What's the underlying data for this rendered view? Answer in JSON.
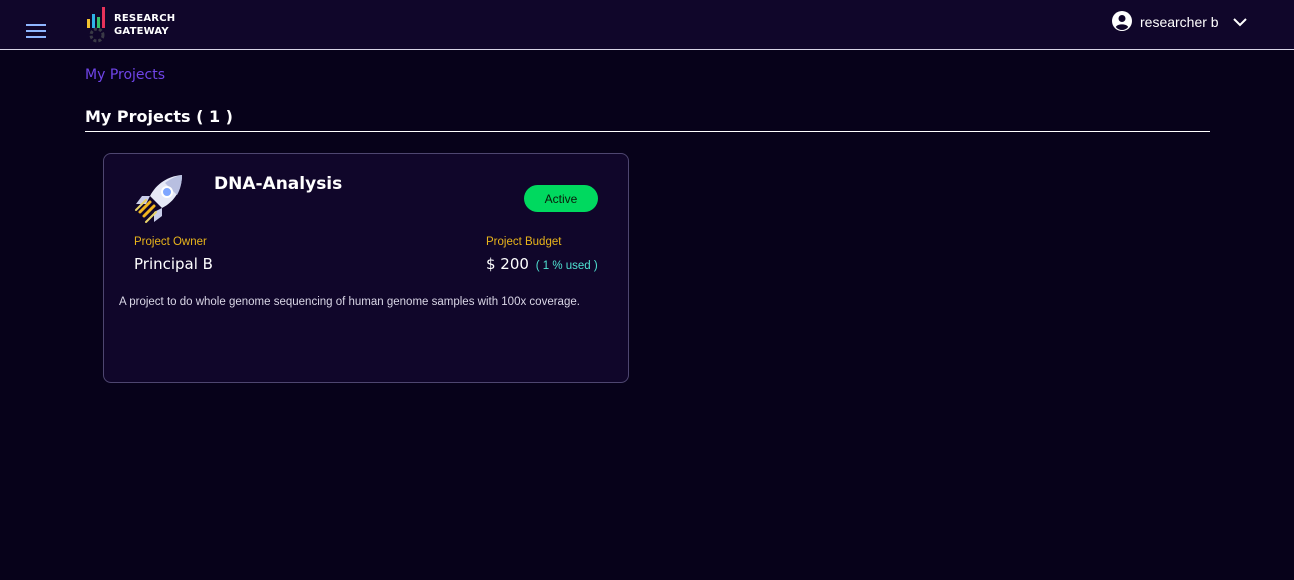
{
  "header": {
    "logo_line1": "RESEARCH",
    "logo_line2": "GATEWAY",
    "user_name": "researcher b"
  },
  "breadcrumb": "My Projects",
  "section": {
    "title": "My Projects ( 1 )"
  },
  "projects": [
    {
      "name": "DNA-Analysis",
      "status": "Active",
      "owner_label": "Project Owner",
      "owner": "Principal B",
      "budget_label": "Project Budget",
      "budget": "$ 200",
      "budget_used": "( 1 % used )",
      "description": "A project to do whole genome sequencing of human genome samples with 100x coverage.",
      "icon": "rocket-icon"
    }
  ],
  "colors": {
    "background": "#07021a",
    "topbar": "#10062a",
    "accent_link": "#6f44e8",
    "status_active": "#00d95f",
    "label_gold": "#e9b51b",
    "budget_used_teal": "#4fe3d2"
  }
}
